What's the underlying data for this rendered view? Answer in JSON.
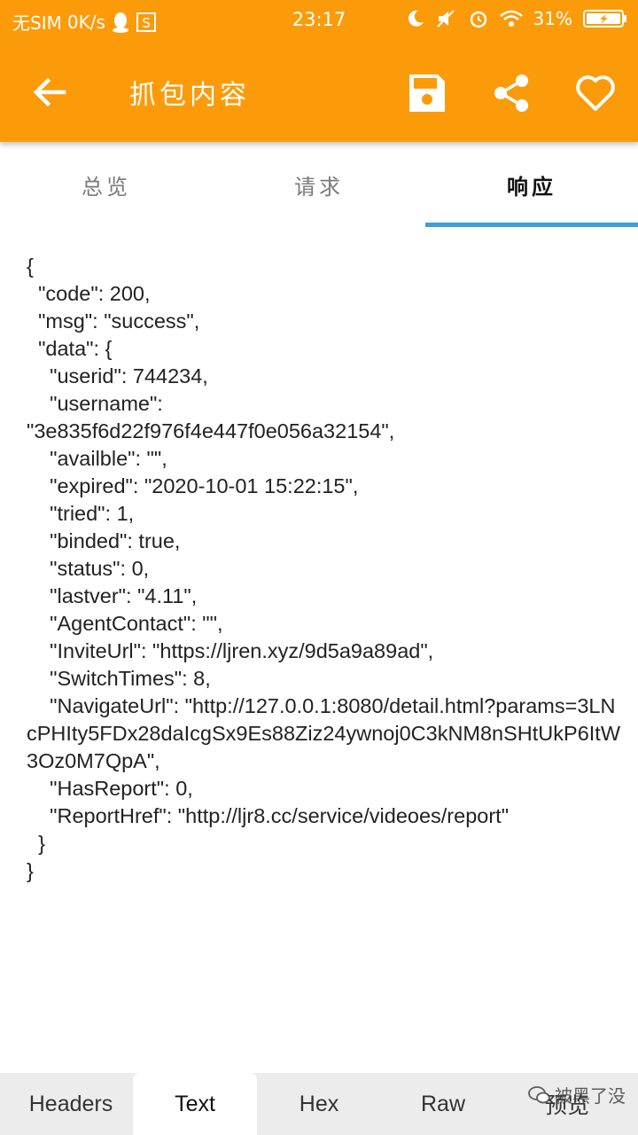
{
  "status_bar": {
    "carrier": "无SIM",
    "speed": "0K/s",
    "time": "23:17",
    "battery": "31%",
    "icons": [
      "qq-icon",
      "s-app-icon",
      "moon-icon",
      "mute-icon",
      "alarm-icon",
      "wifi-icon",
      "battery-charging-icon"
    ]
  },
  "toolbar": {
    "title": "抓包内容",
    "background": "#fb9b0a",
    "icons": [
      "back-arrow-icon",
      "save-icon",
      "share-icon",
      "heart-icon"
    ]
  },
  "tabs": [
    {
      "label": "总览",
      "active": false
    },
    {
      "label": "请求",
      "active": false
    },
    {
      "label": "响应",
      "active": true
    }
  ],
  "tab_indicator_color": "#3d9fd6",
  "response_text": "{\n  \"code\": 200,\n  \"msg\": \"success\",\n  \"data\": {\n    \"userid\": 744234,\n    \"username\":\n\"3e835f6d22f976f4e447f0e056a32154\",\n    \"availble\": \"\",\n    \"expired\": \"2020-10-01 15:22:15\",\n    \"tried\": 1,\n    \"binded\": true,\n    \"status\": 0,\n    \"lastver\": \"4.11\",\n    \"AgentContact\": \"\",\n    \"InviteUrl\": \"https://ljren.xyz/9d5a9a89ad\",\n    \"SwitchTimes\": 8,\n    \"NavigateUrl\": \"http://127.0.0.1:8080/detail.html?params=3LNcPHIty5FDx28daIcgSx9Es88Ziz24ywnoj0C3kNM8nSHtUkP6ItW3Oz0M7QpA\",\n    \"HasReport\": 0,\n    \"ReportHref\": \"http://ljr8.cc/service/videoes/report\"\n  }\n}",
  "bottom_tabs": [
    {
      "label": "Headers",
      "active": false
    },
    {
      "label": "Text",
      "active": true
    },
    {
      "label": "Hex",
      "active": false
    },
    {
      "label": "Raw",
      "active": false
    },
    {
      "label": "预览",
      "active": false
    }
  ],
  "watermark": "被黑了没"
}
